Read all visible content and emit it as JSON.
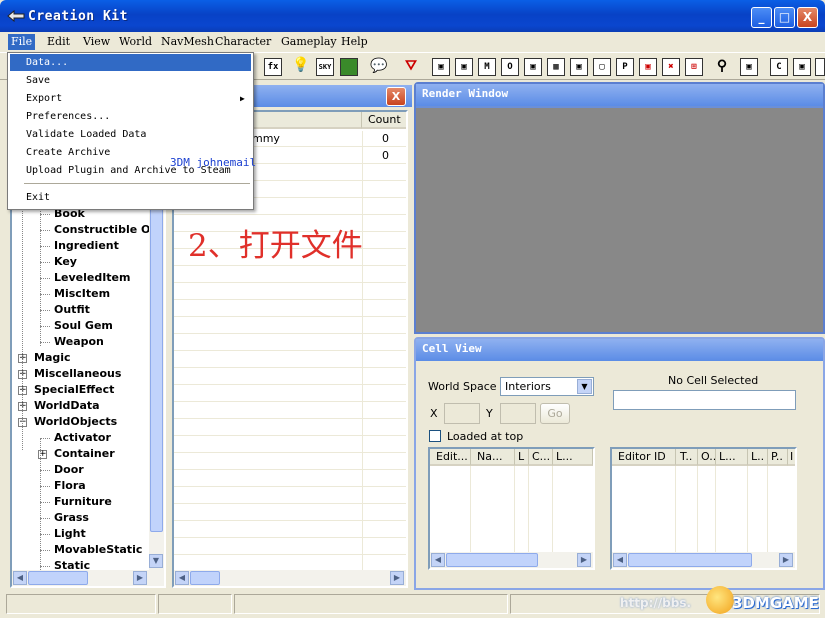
{
  "window": {
    "title": "Creation Kit",
    "buttons": {
      "minimize": "_",
      "maximize": "□",
      "close": "X"
    }
  },
  "menubar": {
    "items": [
      "File",
      "Edit",
      "View",
      "World",
      "NavMesh",
      "Character",
      "Gameplay",
      "Help"
    ]
  },
  "file_menu": {
    "items": [
      "Data...",
      "Save",
      "Export",
      "Preferences...",
      "Validate Loaded Data",
      "Create Archive",
      "Upload Plugin and Archive to Steam",
      "Exit"
    ],
    "selected": "Data...",
    "submenu_arrow": "▶"
  },
  "toolbar": {
    "icons": [
      "sky-label",
      "C",
      "M",
      "O",
      "N",
      "P"
    ],
    "sky_label": "SKY",
    "box_labels": [
      "C",
      "M",
      "O",
      "P"
    ]
  },
  "object_window": {
    "close": "X",
    "count_header": "Count",
    "rows": [
      {
        "name": "mmy",
        "count": "0"
      },
      {
        "name": "",
        "count": "0"
      }
    ],
    "tree": [
      {
        "label": "Book",
        "level": 2
      },
      {
        "label": "Constructible Ob",
        "level": 2
      },
      {
        "label": "Ingredient",
        "level": 2
      },
      {
        "label": "Key",
        "level": 2
      },
      {
        "label": "LeveledItem",
        "level": 2
      },
      {
        "label": "MiscItem",
        "level": 2
      },
      {
        "label": "Outfit",
        "level": 2
      },
      {
        "label": "Soul Gem",
        "level": 2
      },
      {
        "label": "Weapon",
        "level": 2
      },
      {
        "label": "Magic",
        "level": 1,
        "expander": "+"
      },
      {
        "label": "Miscellaneous",
        "level": 1,
        "expander": "+"
      },
      {
        "label": "SpecialEffect",
        "level": 1,
        "expander": "+"
      },
      {
        "label": "WorldData",
        "level": 1,
        "expander": "+"
      },
      {
        "label": "WorldObjects",
        "level": 1,
        "expander": "−"
      },
      {
        "label": "Activator",
        "level": 2
      },
      {
        "label": "Container",
        "level": 2,
        "expander": "+"
      },
      {
        "label": "Door",
        "level": 2
      },
      {
        "label": "Flora",
        "level": 2
      },
      {
        "label": "Furniture",
        "level": 2
      },
      {
        "label": "Grass",
        "level": 2
      },
      {
        "label": "Light",
        "level": 2
      },
      {
        "label": "MovableStatic",
        "level": 2
      },
      {
        "label": "Static",
        "level": 2
      }
    ]
  },
  "render_window": {
    "title": "Render Window"
  },
  "cell_view": {
    "title": "Cell View",
    "world_space_label": "World Space",
    "world_space_value": "Interiors",
    "no_cell_selected": "No Cell Selected",
    "x_label": "X",
    "y_label": "Y",
    "go_button": "Go",
    "loaded_at_top": "Loaded at top",
    "left_columns": [
      "Edit...",
      "Na...",
      "L",
      "C...",
      "L..."
    ],
    "right_columns": [
      "Editor ID",
      "T..",
      "O..",
      "L...",
      "L..",
      "P..",
      "I"
    ]
  },
  "annotation": {
    "watermark_text": "3DM johnemail",
    "step_text": "2、打开文件",
    "step_color": "#e0302a"
  },
  "watermark": {
    "url": "http://bbs.",
    "brand": "3DMGAME"
  },
  "colors": {
    "titlebar": "#0842c6",
    "menu_selected": "#316ac5",
    "panel_title": "#5b8ce6",
    "render_bg": "#888888"
  }
}
